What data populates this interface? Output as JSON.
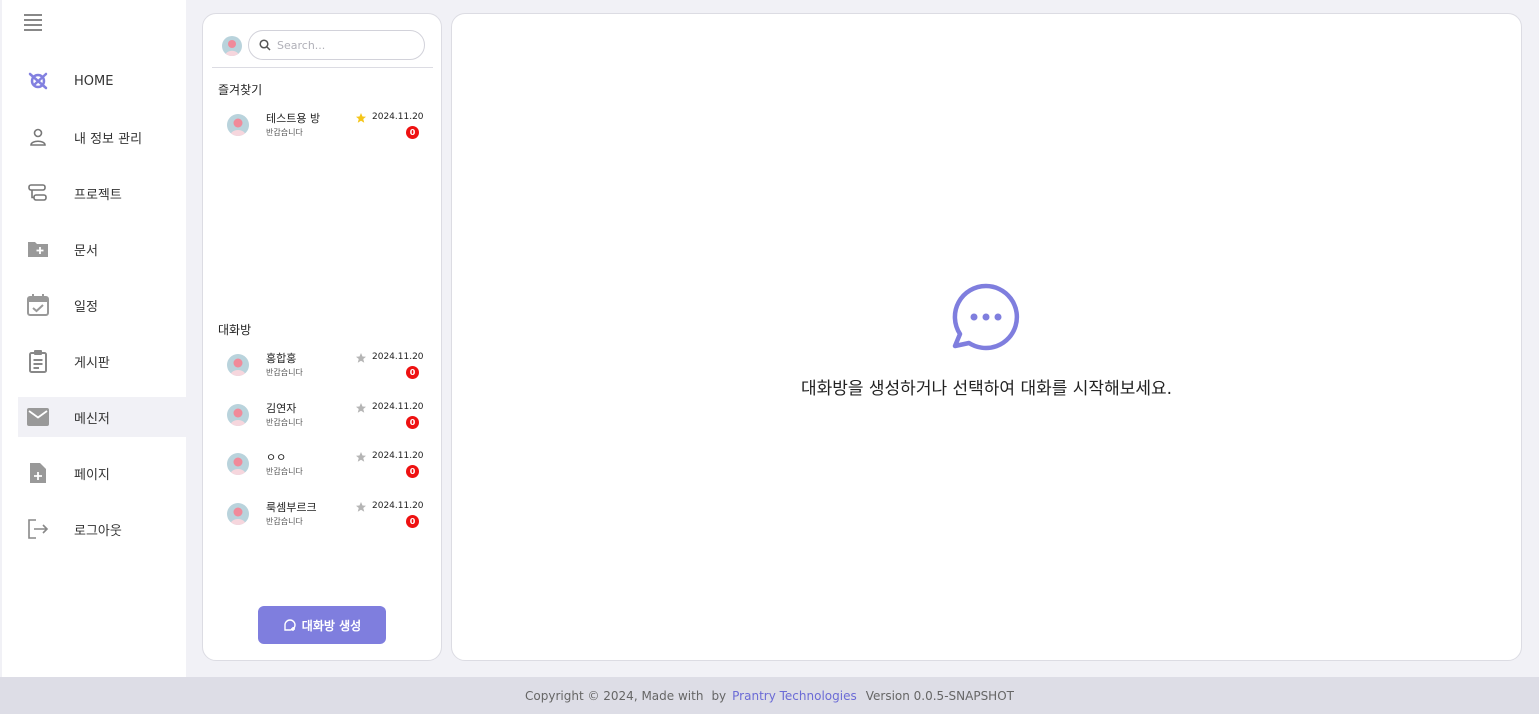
{
  "sidebar": {
    "items": [
      {
        "label": "HOME",
        "icon": "home-logo-icon"
      },
      {
        "label": "내 정보 관리",
        "icon": "user-icon"
      },
      {
        "label": "프로젝트",
        "icon": "project-icon"
      },
      {
        "label": "문서",
        "icon": "folder-add-icon"
      },
      {
        "label": "일정",
        "icon": "calendar-check-icon"
      },
      {
        "label": "게시판",
        "icon": "clipboard-icon"
      },
      {
        "label": "메신저",
        "icon": "mail-icon"
      },
      {
        "label": "페이지",
        "icon": "file-add-icon"
      },
      {
        "label": "로그아웃",
        "icon": "logout-icon"
      }
    ],
    "active_index": 6,
    "accent_color": "#8280e0"
  },
  "search": {
    "placeholder": "Search..."
  },
  "favorites": {
    "title": "즐겨찾기",
    "rooms": [
      {
        "name": "테스트용 방",
        "message": "반갑습니다",
        "date": "2024.11.20",
        "unread": "0",
        "starred": true
      }
    ]
  },
  "rooms_section": {
    "title": "대화방",
    "rooms": [
      {
        "name": "홍합홍",
        "message": "반갑습니다",
        "date": "2024.11.20",
        "unread": "0",
        "starred": false
      },
      {
        "name": "김연자",
        "message": "반갑습니다",
        "date": "2024.11.20",
        "unread": "0",
        "starred": false
      },
      {
        "name": "ㅇㅇ",
        "message": "반갑습니다",
        "date": "2024.11.20",
        "unread": "0",
        "starred": false
      },
      {
        "name": "룩셈부르크",
        "message": "반갑습니다",
        "date": "2024.11.20",
        "unread": "0",
        "starred": false
      }
    ]
  },
  "create_button": {
    "label": "대화방 생성"
  },
  "main": {
    "empty_message": "대화방을 생성하거나 선택하여 대화를 시작해보세요."
  },
  "footer": {
    "copyright": "Copyright © 2024, Made with",
    "by": "by",
    "company": "Prantry Technologies",
    "version": "Version 0.0.5-SNAPSHOT"
  },
  "colors": {
    "accent": "#7f7ede",
    "badge": "#ee1111",
    "star_active": "#f5c518",
    "star_inactive": "#b5b5b5"
  }
}
